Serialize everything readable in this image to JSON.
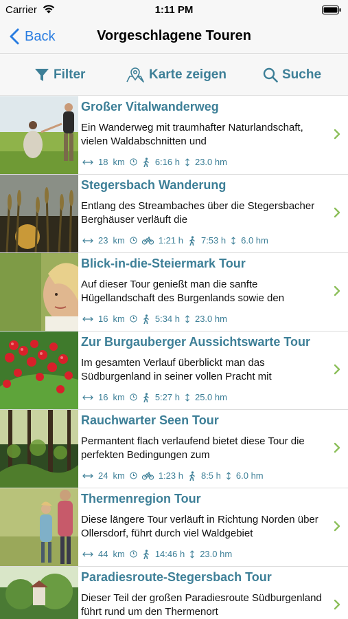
{
  "status_bar": {
    "carrier": "Carrier",
    "time": "1:11 PM"
  },
  "nav": {
    "back_label": "Back",
    "title": "Vorgeschlagene Touren"
  },
  "toolbar": {
    "filter_label": "Filter",
    "map_label": "Karte zeigen",
    "search_label": "Suche"
  },
  "colors": {
    "accent": "#3d7f97",
    "ios_blue": "#2a7de1",
    "chevron": "#8cbf5a"
  },
  "tours": [
    {
      "title": "Großer Vitalwanderweg",
      "description": "Ein Wanderweg mit traumhafter Naturlandschaft, vielen Waldabschnitten und",
      "distance": "18",
      "unit": "km",
      "bike": "",
      "hike": "6:16 h",
      "elevation": "23.0 hm"
    },
    {
      "title": "Stegersbach Wanderung",
      "description": "Entlang des Streambaches über die Stegersbacher Berghäuser verläuft die",
      "distance": "23",
      "unit": "km",
      "bike": "1:21 h",
      "hike": "7:53 h",
      "elevation": "6.0 hm"
    },
    {
      "title": "Blick-in-die-Steiermark Tour",
      "description": "Auf dieser Tour genießt man die sanfte Hügellandschaft des Burgenlands sowie den",
      "distance": "16",
      "unit": "km",
      "bike": "",
      "hike": "5:34 h",
      "elevation": "23.0 hm"
    },
    {
      "title": "Zur Burgauberger Aussichtswarte Tour",
      "description": "Im gesamten Verlauf überblickt man das Südburgenland in seiner vollen Pracht mit",
      "distance": "16",
      "unit": "km",
      "bike": "",
      "hike": "5:27 h",
      "elevation": "25.0 hm"
    },
    {
      "title": "Rauchwarter Seen Tour",
      "description": "Permantent flach verlaufend bietet diese Tour die perfekten Bedingungen zum",
      "distance": "24",
      "unit": "km",
      "bike": "1:23 h",
      "hike": "8:5 h",
      "elevation": "6.0 hm"
    },
    {
      "title": "Thermenregion Tour",
      "description": "Diese längere Tour verläuft in Richtung Norden über Ollersdorf, führt durch viel Waldgebiet",
      "distance": "44",
      "unit": "km",
      "bike": "",
      "hike": "14:46 h",
      "elevation": "23.0 hm"
    },
    {
      "title": "Paradiesroute-Stegersbach Tour",
      "description": "Dieser Teil der großen Paradiesroute Südburgenland führt rund um den Thermenort",
      "distance": "",
      "unit": "",
      "bike": "",
      "hike": "",
      "elevation": ""
    }
  ]
}
